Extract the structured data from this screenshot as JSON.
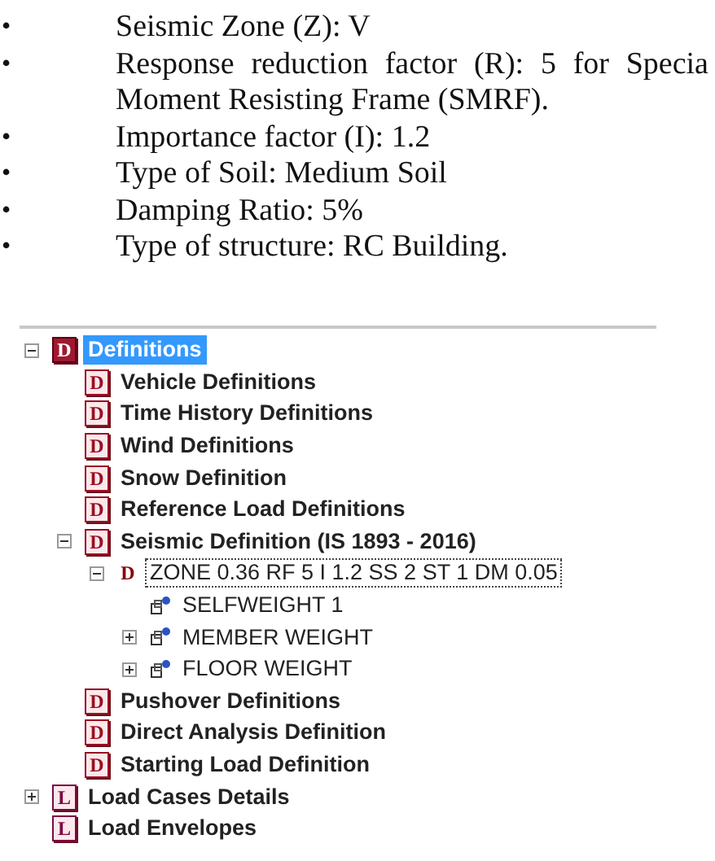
{
  "document": {
    "bullets": [
      {
        "bullet": "•",
        "lines": [
          "Seismic Zone (Z): V"
        ]
      },
      {
        "bullet": "•",
        "lines": [
          "Response reduction factor (R): 5 for Specia",
          "Moment Resisting Frame (SMRF)."
        ]
      },
      {
        "bullet": "•",
        "lines": [
          "Importance factor (I): 1.2"
        ]
      },
      {
        "bullet": "•",
        "lines": [
          "Type of Soil: Medium Soil"
        ]
      },
      {
        "bullet": "•",
        "lines": [
          "Damping Ratio: 5%"
        ]
      },
      {
        "bullet": "•",
        "lines": [
          "Type of structure: RC Building."
        ]
      }
    ]
  },
  "tree": {
    "items": [
      {
        "label": "Definitions",
        "icon": {
          "kind": "root",
          "letter": "D"
        },
        "bold": true,
        "selected": true,
        "expanded": true,
        "children": [
          {
            "label": "Vehicle Definitions",
            "icon": {
              "kind": "box",
              "letter": "D"
            },
            "bold": true,
            "selected": false
          },
          {
            "label": "Time History Definitions",
            "icon": {
              "kind": "box",
              "letter": "D"
            },
            "bold": true,
            "selected": false
          },
          {
            "label": "Wind Definitions",
            "icon": {
              "kind": "box",
              "letter": "D"
            },
            "bold": true,
            "selected": false
          },
          {
            "label": "Snow Definition",
            "icon": {
              "kind": "box",
              "letter": "D"
            },
            "bold": true,
            "selected": false
          },
          {
            "label": "Reference Load Definitions",
            "icon": {
              "kind": "box",
              "letter": "D"
            },
            "bold": true,
            "selected": false
          },
          {
            "label": "Seismic Definition (IS 1893 - 2016)",
            "icon": {
              "kind": "box",
              "letter": "D"
            },
            "bold": true,
            "selected": false,
            "expanded": true,
            "children": [
              {
                "label": "ZONE 0.36 RF 5 I 1.2 SS 2 ST 1 DM 0.05",
                "icon": {
                  "kind": "plain",
                  "letter": "D"
                },
                "bold": false,
                "selected": false,
                "focused": true,
                "expanded": true,
                "children": [
                  {
                    "label": "SELFWEIGHT 1",
                    "icon": {
                      "kind": "load"
                    },
                    "bold": false,
                    "selected": false
                  },
                  {
                    "label": "MEMBER WEIGHT",
                    "icon": {
                      "kind": "load"
                    },
                    "bold": false,
                    "selected": false,
                    "expanded": false
                  },
                  {
                    "label": "FLOOR WEIGHT",
                    "icon": {
                      "kind": "load"
                    },
                    "bold": false,
                    "selected": false,
                    "expanded": false
                  }
                ]
              }
            ]
          },
          {
            "label": "Pushover Definitions",
            "icon": {
              "kind": "box",
              "letter": "D"
            },
            "bold": true,
            "selected": false
          },
          {
            "label": "Direct Analysis Definition",
            "icon": {
              "kind": "box",
              "letter": "D"
            },
            "bold": true,
            "selected": false
          },
          {
            "label": "Starting Load Definition",
            "icon": {
              "kind": "box",
              "letter": "D"
            },
            "bold": true,
            "selected": false
          }
        ]
      },
      {
        "label": "Load Cases Details",
        "icon": {
          "kind": "root-l",
          "letter": "L"
        },
        "bold": true,
        "selected": false,
        "expanded": false
      },
      {
        "label": "Load Envelopes",
        "icon": {
          "kind": "root-l",
          "letter": "L"
        },
        "bold": true,
        "selected": false
      }
    ]
  }
}
